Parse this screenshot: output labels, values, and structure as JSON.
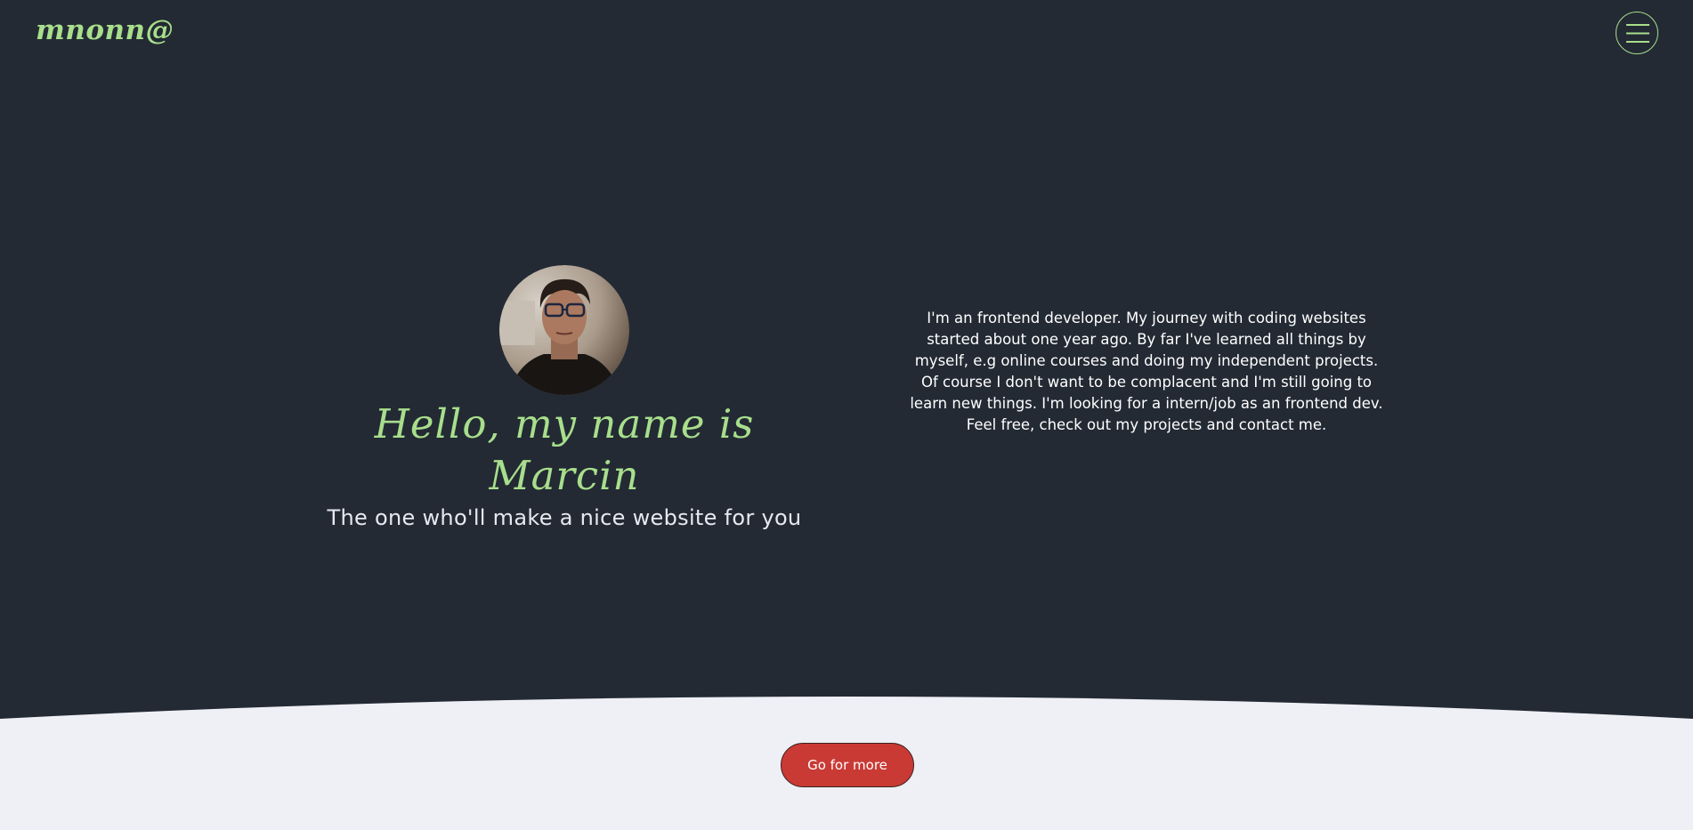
{
  "header": {
    "logo": "mnonn@",
    "menu_icon": "hamburger-menu-icon"
  },
  "hero": {
    "avatar_alt": "profile-photo",
    "greeting": "Hello, my name is Marcin",
    "tagline": "The one who'll make a nice website for you"
  },
  "about": {
    "text": "I'm an frontend developer. My journey with coding websites started about one year ago. By far I've learned all things by myself, e.g online courses and doing my independent projects. Of course I don't want to be complacent and I'm still going to learn new things. I'm looking for a intern/job as an frontend dev. Feel free, check out my projects and contact me."
  },
  "cta": {
    "label": "Go for more"
  },
  "colors": {
    "background": "#232a34",
    "accent": "#a8de8c",
    "light_section": "#eff0f5",
    "button": "#c93a35"
  }
}
